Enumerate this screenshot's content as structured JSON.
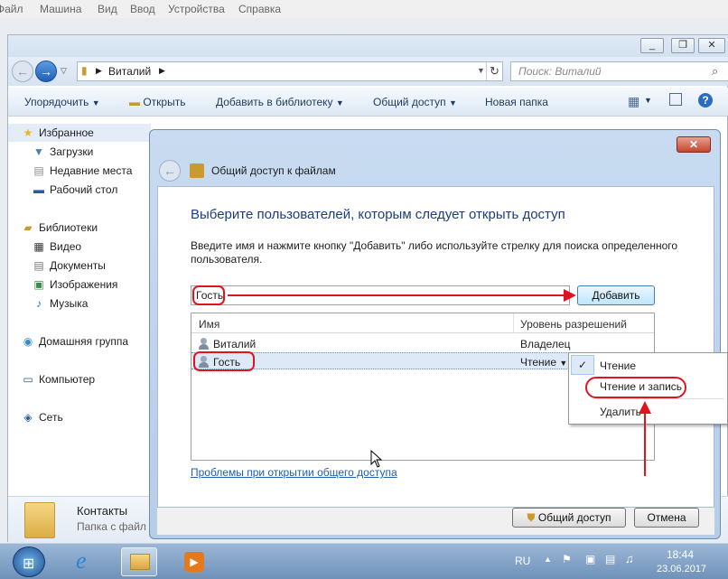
{
  "vm_menu": [
    "Файл",
    "Машина",
    "Вид",
    "Ввод",
    "Устройства",
    "Справка"
  ],
  "explorer": {
    "address_path": "Виталий",
    "search_placeholder": "Поиск: Виталий",
    "toolbar": {
      "organize": "Упорядочить",
      "open": "Открыть",
      "add_to_library": "Добавить в библиотеку",
      "share": "Общий доступ",
      "new_folder": "Новая папка"
    },
    "nav": {
      "favorites": "Избранное",
      "downloads": "Загрузки",
      "recent": "Недавние места",
      "desktop": "Рабочий стол",
      "libraries": "Библиотеки",
      "video": "Видео",
      "documents": "Документы",
      "images": "Изображения",
      "music": "Музыка",
      "homegroup": "Домашняя группа",
      "computer": "Компьютер",
      "network": "Сеть"
    },
    "details": {
      "name": "Контакты",
      "type": "Папка с файл"
    }
  },
  "dialog": {
    "title": "Общий доступ к файлам",
    "heading": "Выберите пользователей, которым следует открыть доступ",
    "instruction": "Введите имя и нажмите кнопку \"Добавить\" либо используйте стрелку для поиска определенного пользователя.",
    "input_value": "Гость",
    "add_button": "Добавить",
    "columns": {
      "name": "Имя",
      "permission": "Уровень разрешений"
    },
    "rows": [
      {
        "name": "Виталий",
        "permission": "Владелец"
      },
      {
        "name": "Гость",
        "permission": "Чтение"
      }
    ],
    "help_link": "Проблемы при открытии общего доступа",
    "share_button": "Общий доступ",
    "cancel_button": "Отмена"
  },
  "permission_menu": {
    "read": "Чтение",
    "read_write": "Чтение и запись",
    "remove": "Удалить",
    "checked": "✓"
  },
  "taskbar": {
    "lang": "RU",
    "time": "18:44",
    "date": "23.06.2017"
  },
  "colors": {
    "annotation": "#e0141e",
    "heading": "#1c3d82",
    "link": "#1c5fb5"
  }
}
